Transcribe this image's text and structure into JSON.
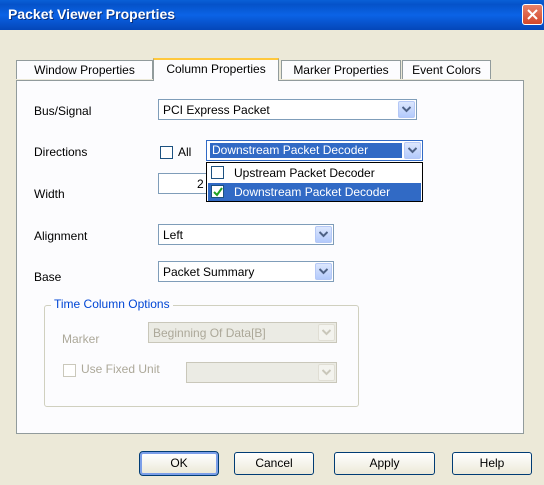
{
  "window": {
    "title": "Packet Viewer Properties"
  },
  "tabs": [
    {
      "label": "Window Properties"
    },
    {
      "label": "Column Properties"
    },
    {
      "label": "Marker Properties"
    },
    {
      "label": "Event Colors"
    }
  ],
  "fields": {
    "bus_signal": {
      "label": "Bus/Signal",
      "value": "PCI Express Packet"
    },
    "directions": {
      "label": "Directions",
      "all_label": "All",
      "all_checked": false,
      "value": "Downstream Packet Decoder"
    },
    "width": {
      "label": "Width",
      "value": "2"
    },
    "alignment": {
      "label": "Alignment",
      "value": "Left"
    },
    "base": {
      "label": "Base",
      "value": "Packet Summary"
    }
  },
  "directions_dropdown": {
    "options": [
      {
        "label": "Upstream Packet Decoder",
        "checked": false,
        "highlighted": false
      },
      {
        "label": "Downstream Packet Decoder",
        "checked": true,
        "highlighted": true
      }
    ]
  },
  "time_column_options": {
    "title": "Time Column Options",
    "marker_label": "Marker",
    "marker_value": "Beginning Of Data[B]",
    "use_fixed_unit_label": "Use Fixed Unit",
    "use_fixed_unit_checked": false,
    "unit_value": ""
  },
  "buttons": {
    "ok": "OK",
    "cancel": "Cancel",
    "apply": "Apply",
    "help": "Help"
  }
}
